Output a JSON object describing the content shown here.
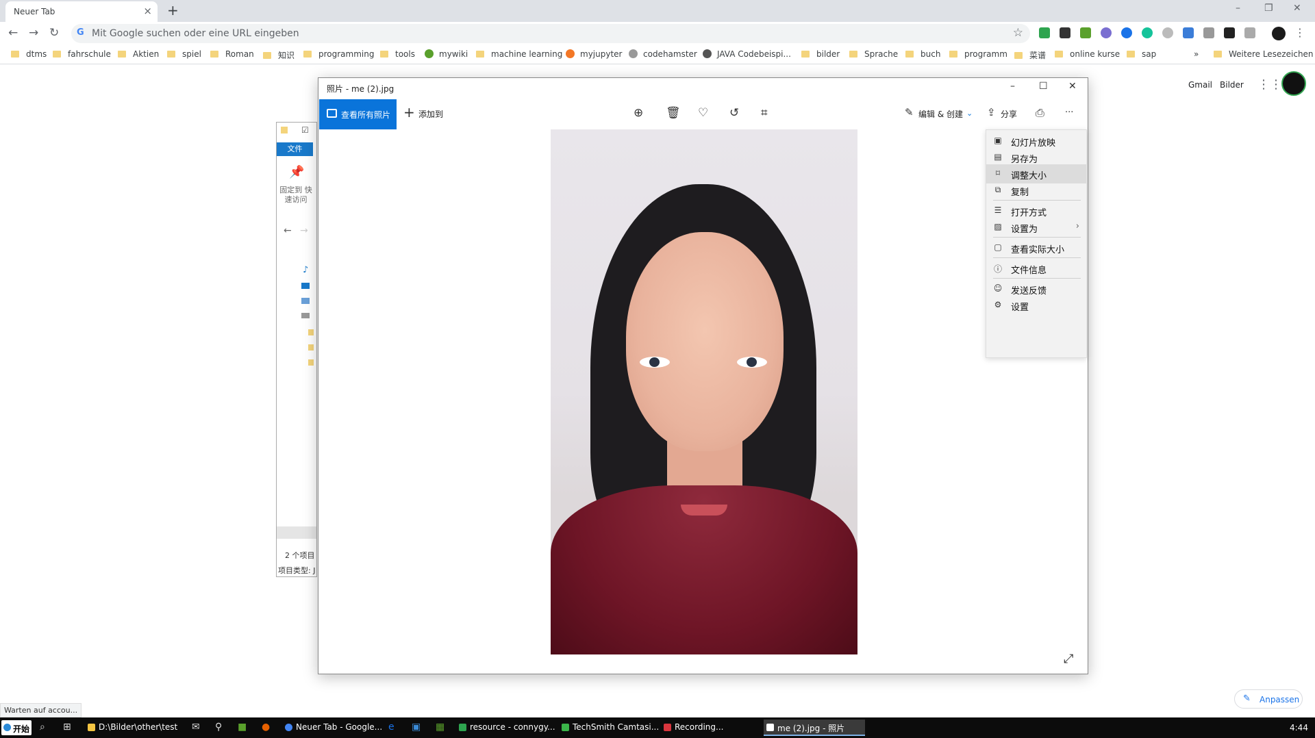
{
  "chrome": {
    "tab_title": "Neuer Tab",
    "tab_close": "×",
    "new_tab": "+",
    "omnibox_placeholder": "Mit Google suchen oder eine URL eingeben",
    "minimize": "–",
    "restore": "❐",
    "close": "✕"
  },
  "bookmarks": {
    "items": [
      "dtms",
      "fahrschule",
      "Aktien",
      "spiel",
      "Roman",
      "知识",
      "programming",
      "tools",
      "mywiki",
      "machine learning",
      "myjupyter",
      "codehamster",
      "JAVA Codebeispi...",
      "bilder",
      "Sprache",
      "buch",
      "programm",
      "菜谱",
      "online kurse",
      "sap"
    ],
    "overflow": "»",
    "other": "Weitere Lesezeichen"
  },
  "google": {
    "gmail": "Gmail",
    "images": "Bilder",
    "customize": "Anpassen"
  },
  "status_bubble": "Warten auf accou...",
  "explorer": {
    "file_tab": "文件",
    "pin_label": "固定到 快速访问",
    "item_count": "2 个项目",
    "item_type": "项目类型: J"
  },
  "photos": {
    "title": "照片 - me (2).jpg",
    "view_all": "查看所有照片",
    "add_to": "添加到",
    "edit_create": "编辑 & 创建",
    "share": "分享",
    "more": "···",
    "menu": [
      {
        "icon": "slideshow-icon",
        "label": "幻灯片放映"
      },
      {
        "icon": "save-as-icon",
        "label": "另存为"
      },
      {
        "icon": "resize-icon",
        "label": "调整大小"
      },
      {
        "icon": "copy-icon",
        "label": "复制"
      },
      {
        "icon": "open-with-icon",
        "label": "打开方式"
      },
      {
        "icon": "set-as-icon",
        "label": "设置为"
      },
      {
        "icon": "actual-size-icon",
        "label": "查看实际大小"
      },
      {
        "icon": "file-info-icon",
        "label": "文件信息"
      },
      {
        "icon": "feedback-icon",
        "label": "发送反馈"
      },
      {
        "icon": "settings-icon",
        "label": "设置"
      }
    ]
  },
  "taskbar": {
    "start": "开始",
    "items": [
      {
        "label": "D:\\Bilder\\other\\test",
        "color": "#f4c542"
      },
      {
        "label": "Neuer Tab - Google...",
        "color": "#4285f4"
      },
      {
        "label": "resource - connygy...",
        "color": "#2ea44f"
      },
      {
        "label": "TechSmith Camtasi...",
        "color": "#3bb54a"
      },
      {
        "label": "Recording...",
        "color": "#d9363e"
      },
      {
        "label": "me (2).jpg - 照片",
        "color": "#ffffff"
      }
    ],
    "clock": "4:44"
  }
}
